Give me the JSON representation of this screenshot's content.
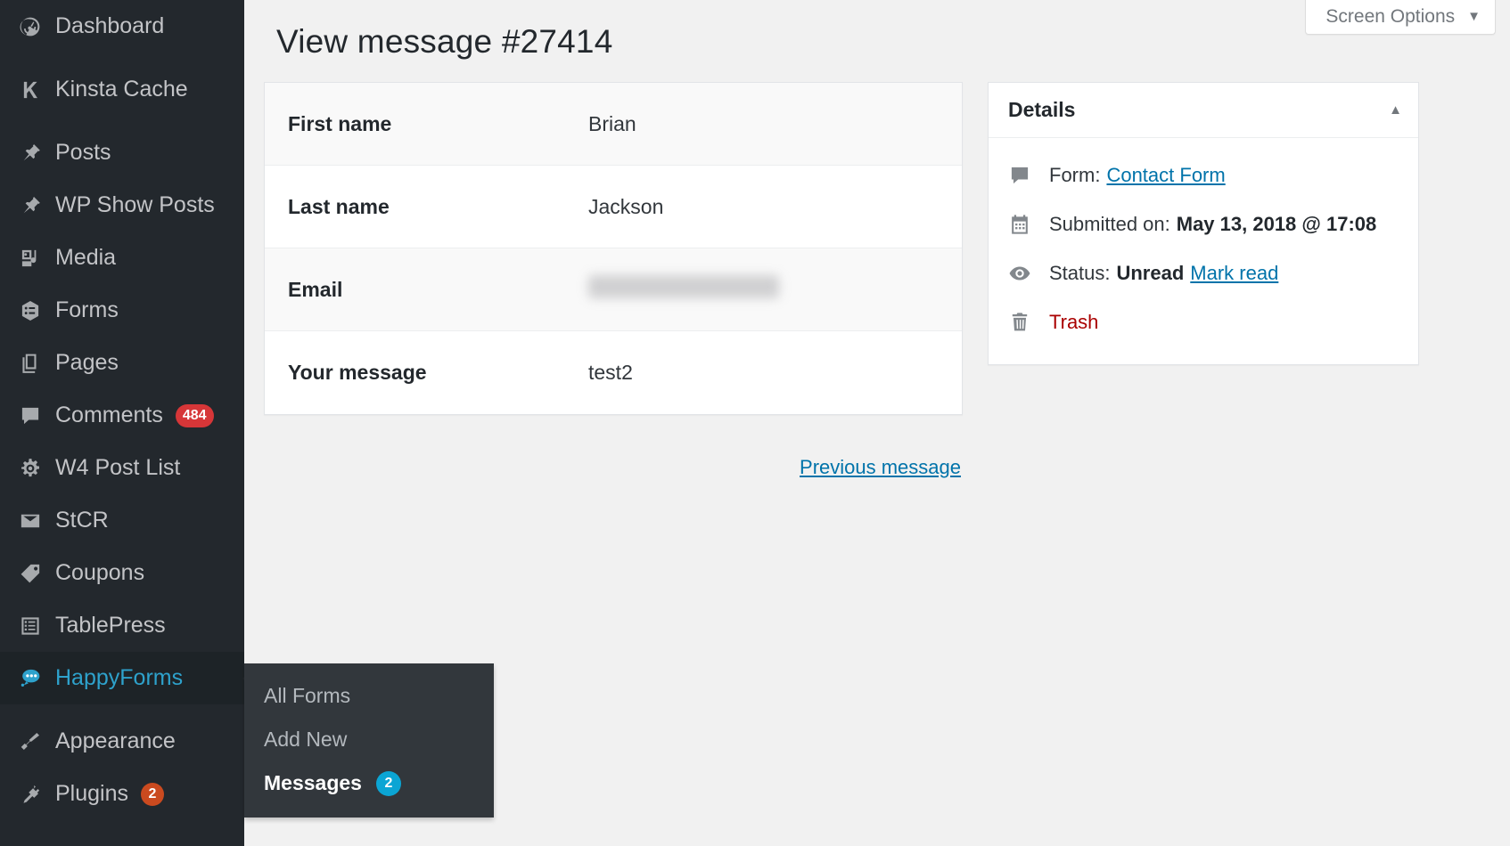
{
  "sidebar": {
    "items": [
      {
        "label": "Dashboard",
        "icon": "dashboard-icon",
        "current": false,
        "count": null,
        "spacer_after": true
      },
      {
        "label": "Kinsta Cache",
        "icon": "kinsta-k-icon",
        "current": false,
        "count": null,
        "spacer_after": true
      },
      {
        "label": "Posts",
        "icon": "pin-icon",
        "current": false,
        "count": null,
        "spacer_after": false
      },
      {
        "label": "WP Show Posts",
        "icon": "pin-icon",
        "current": false,
        "count": null,
        "spacer_after": false
      },
      {
        "label": "Media",
        "icon": "media-icon",
        "current": false,
        "count": null,
        "spacer_after": false
      },
      {
        "label": "Forms",
        "icon": "forms-icon",
        "current": false,
        "count": null,
        "spacer_after": false
      },
      {
        "label": "Pages",
        "icon": "pages-icon",
        "current": false,
        "count": null,
        "spacer_after": false
      },
      {
        "label": "Comments",
        "icon": "comment-bubble-icon",
        "current": false,
        "count": "484",
        "spacer_after": false
      },
      {
        "label": "W4 Post List",
        "icon": "gear-icon",
        "current": false,
        "count": null,
        "spacer_after": false
      },
      {
        "label": "StCR",
        "icon": "envelope-icon",
        "current": false,
        "count": null,
        "spacer_after": false
      },
      {
        "label": "Coupons",
        "icon": "tag-icon",
        "current": false,
        "count": null,
        "spacer_after": false
      },
      {
        "label": "TablePress",
        "icon": "list-icon",
        "current": false,
        "count": null,
        "spacer_after": false
      },
      {
        "label": "HappyForms",
        "icon": "happyforms-bubble-icon",
        "current": true,
        "count": null,
        "spacer_after": true
      },
      {
        "label": "Appearance",
        "icon": "paintbrush-icon",
        "current": false,
        "count": null,
        "spacer_after": false
      },
      {
        "label": "Plugins",
        "icon": "plug-icon",
        "current": false,
        "count": "2",
        "spacer_after": false
      }
    ],
    "submenu": {
      "items": [
        {
          "label": "All Forms",
          "current": false,
          "count": null
        },
        {
          "label": "Add New",
          "current": false,
          "count": null
        },
        {
          "label": "Messages",
          "current": true,
          "count": "2"
        }
      ]
    }
  },
  "screen_options": {
    "label": "Screen Options",
    "caret": "▼"
  },
  "page": {
    "title": "View message #27414"
  },
  "message": {
    "rows": [
      {
        "label": "First name",
        "value": "Brian",
        "redacted": false
      },
      {
        "label": "Last name",
        "value": "Jackson",
        "redacted": false
      },
      {
        "label": "Email",
        "value": "",
        "redacted": true
      },
      {
        "label": "Your message",
        "value": "test2",
        "redacted": false
      }
    ],
    "previous_link": "Previous message"
  },
  "details": {
    "title": "Details",
    "caret": "▲",
    "rows": [
      {
        "icon": "comment-bubble-icon",
        "prefix": "Form:",
        "link": "Contact Form",
        "value": "",
        "suffix": "",
        "link_style": "normal"
      },
      {
        "icon": "calendar-icon",
        "prefix": "Submitted on:",
        "link": "",
        "value": "May 13, 2018 @ 17:08",
        "suffix": "",
        "link_style": "normal"
      },
      {
        "icon": "eye-icon",
        "prefix": "Status:",
        "link": "Mark read",
        "value": "Unread",
        "suffix": "",
        "link_style": "normal"
      },
      {
        "icon": "trash-icon",
        "prefix": "",
        "link": "Trash",
        "value": "",
        "suffix": "",
        "link_style": "danger"
      }
    ]
  },
  "colors": {
    "sidebar_bg": "#23282d",
    "sidebar_current_bg": "#1d2327",
    "accent_blue": "#2ea2cc",
    "link_blue": "#0073aa",
    "badge_red": "#d63638",
    "badge_orange": "#ca4a1f",
    "badge_cyan": "#0ba5d4",
    "danger_red": "#a00000",
    "content_bg": "#f1f1f1"
  }
}
